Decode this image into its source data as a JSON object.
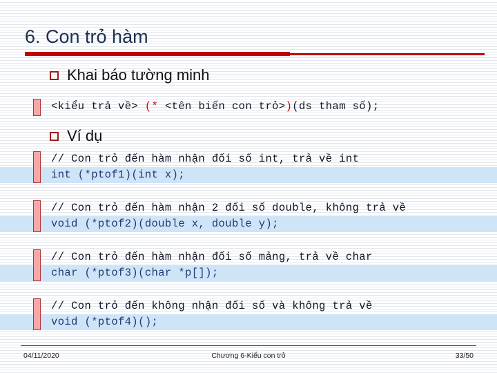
{
  "slide": {
    "title": "6. Con trỏ hàm",
    "accent_color": "#c00000",
    "title_color": "#1b3050",
    "bullet_color": "#9e1b1b",
    "highlight_color": "#cfe4f7",
    "bar_fill_color": "#f6a8a8",
    "bar_border_color": "#b03535"
  },
  "bullets": [
    {
      "label": "Khai báo tường minh"
    },
    {
      "label": "Ví dụ"
    }
  ],
  "syntax_block": {
    "part_before": "<kiểu trả về> ",
    "part_red_open": "(* ",
    "part_inner": "<tên biến con trỏ>",
    "part_red_close": ")",
    "part_after": "(ds tham số);"
  },
  "examples": [
    {
      "comment": "// Con trỏ đến hàm nhận đối số int, trả về int",
      "code": "int (*ptof1)(int x);"
    },
    {
      "comment": "// Con trỏ đến hàm nhận 2 đối số double, không trả về",
      "code": "void (*ptof2)(double x, double y);"
    },
    {
      "comment": "// Con trỏ đến hàm nhận đối số mảng, trả về char",
      "code": "char (*ptof3)(char *p[]);"
    },
    {
      "comment": "// Con trỏ đến không nhận đối số và không trả về",
      "code": "void (*ptof4)();"
    }
  ],
  "footer": {
    "date": "04/11/2020",
    "center": "Chương 6-Kiểu con trỏ",
    "page": "33/50"
  }
}
